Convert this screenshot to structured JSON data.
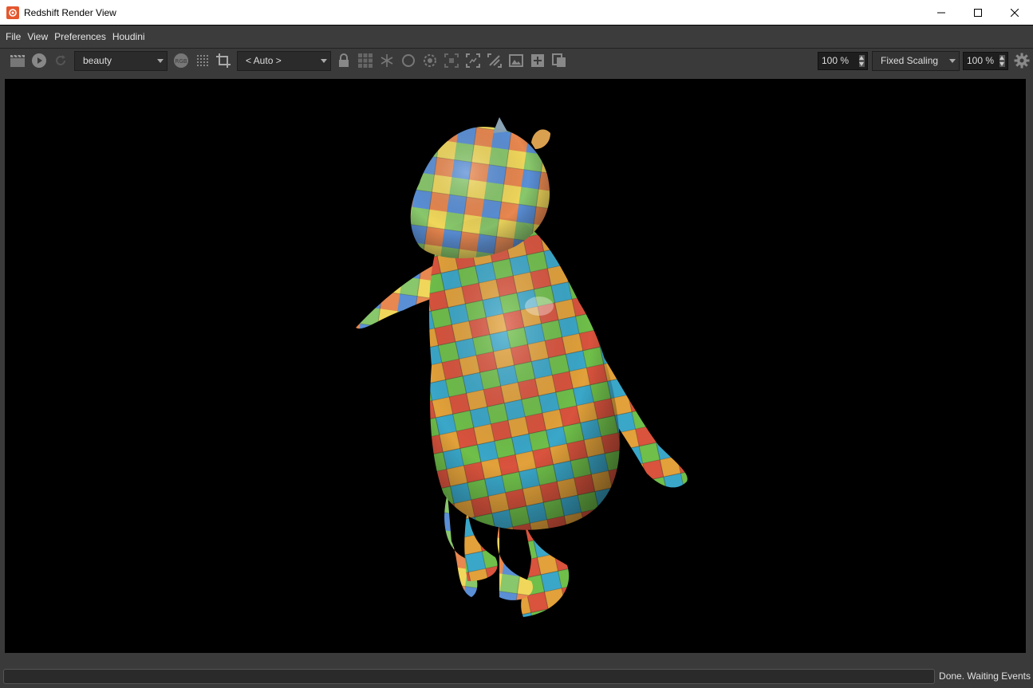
{
  "window": {
    "title": "Redshift Render View",
    "icon": "redshift-app-icon",
    "controls": [
      "minimize-icon",
      "maximize-icon",
      "close-icon"
    ]
  },
  "menu": [
    "File",
    "View",
    "Preferences",
    "Houdini"
  ],
  "toolbar": {
    "icons": [
      "clapper-icon",
      "play-icon",
      "refresh-icon",
      "rgb-icon",
      "grid-dots-icon",
      "crop-icon",
      "lock-icon",
      "tiles-icon",
      "snowflake-icon",
      "circle-icon",
      "target-icon",
      "focus-icon",
      "select-region-icon",
      "compare-icon",
      "image-icon",
      "add-snapshot-icon",
      "copy-icon",
      "gear-icon"
    ],
    "aov": {
      "value": "beauty"
    },
    "camera": {
      "value": "< Auto >"
    },
    "zoom": {
      "value": "100 %"
    },
    "scaling": {
      "value": "Fixed Scaling"
    },
    "scale": {
      "value": "100 %"
    }
  },
  "viewport": {
    "subject": "uv-checker-textured-creature-render"
  },
  "status": {
    "text": "Done. Waiting Events",
    "progress": 0
  },
  "colors": {
    "accent": "#e4572e",
    "panel": "#3a3a3a",
    "viewport_bg": "#000000"
  }
}
